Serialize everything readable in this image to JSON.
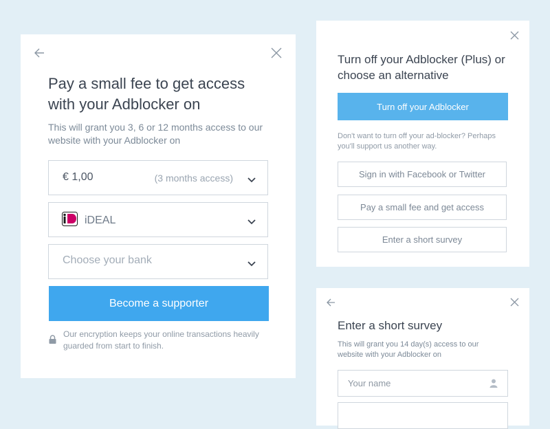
{
  "fee_card": {
    "title": "Pay a small fee to get access with your Adblocker on",
    "subtitle": "This will grant you 3, 6 or 12 months access to our website with your Adblocker on",
    "amount_select": {
      "value": "€ 1,00",
      "meta": "(3 months access)"
    },
    "payment_select": {
      "value": "iDEAL",
      "logo_text": "iDEAL"
    },
    "bank_select": {
      "placeholder": "Choose your bank"
    },
    "submit_label": "Become a supporter",
    "security_note": "Our encryption keeps your online transactions heavily guarded from start to finish.",
    "icons": {
      "back": "arrow-left-icon",
      "close": "close-icon",
      "chevron": "chevron-down-icon",
      "lock": "lock-icon"
    }
  },
  "options_card": {
    "title": "Turn off your Adblocker (Plus) or choose an alternative",
    "primary_label": "Turn off your Adblocker",
    "hint": "Don't want to turn off your ad-blocker? Perhaps you'll support us another way.",
    "options": [
      {
        "label": "Sign in with Facebook or Twitter"
      },
      {
        "label": "Pay a small fee and get access"
      },
      {
        "label": "Enter a short survey"
      }
    ]
  },
  "survey_card": {
    "title": "Enter a short survey",
    "hint": "This will grant you 14 day(s) access to our website with your Adblocker on",
    "name_input": {
      "placeholder": "Your name",
      "value": ""
    }
  },
  "colors": {
    "background": "#e2eff6",
    "primary": "#3fa7ee",
    "primary_light": "#58b3ec",
    "text": "#3b4451",
    "muted": "#7c8a98",
    "border": "#cfd6dd",
    "ideal_pink": "#cc0066"
  }
}
